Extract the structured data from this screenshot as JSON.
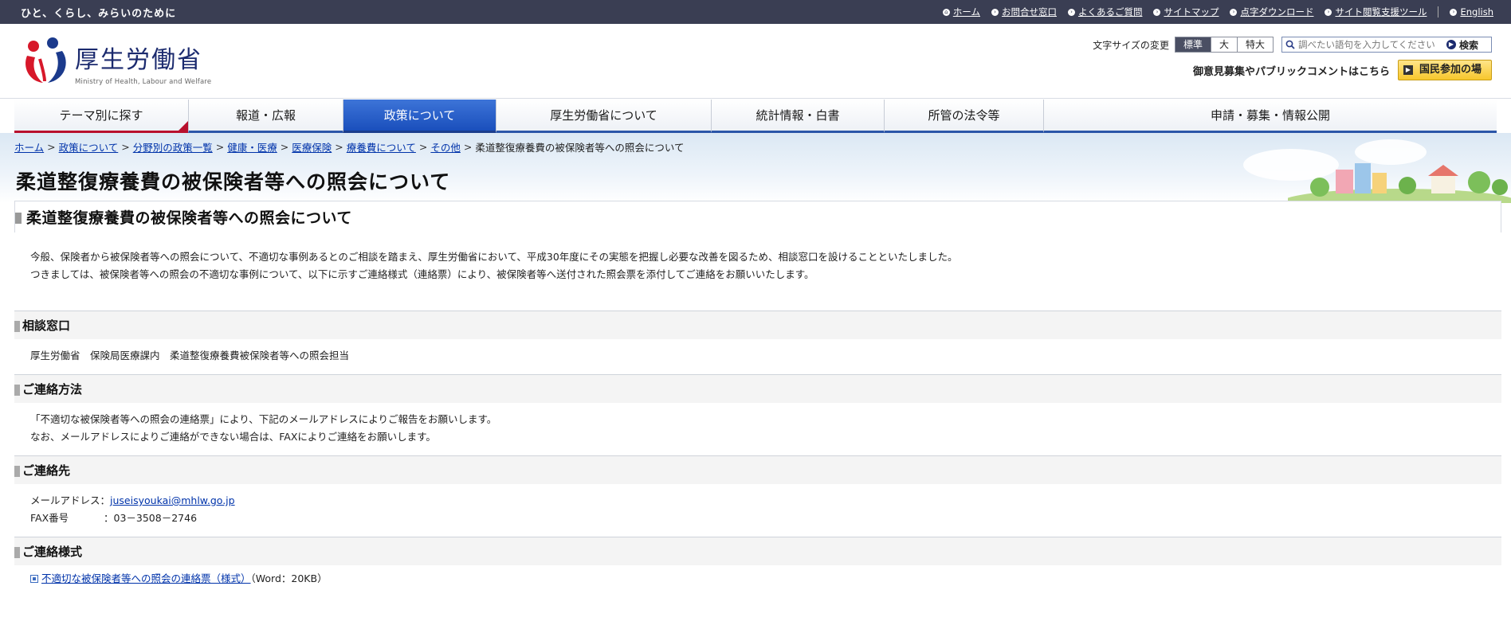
{
  "topbar": {
    "tagline": "ひと、くらし、みらいのために",
    "links": [
      "ホーム",
      "お問合せ窓口",
      "よくあるご質問",
      "サイトマップ",
      "点字ダウンロード",
      "サイト閲覧支援ツール"
    ],
    "english": "English"
  },
  "logo": {
    "jp": "厚生労働省",
    "en": "Ministry of Health, Labour and Welfare"
  },
  "font_size": {
    "label": "文字サイズの変更",
    "options": [
      "標準",
      "大",
      "特大"
    ],
    "selected": "標準"
  },
  "search": {
    "placeholder": "調べたい語句を入力してください",
    "button": "検索"
  },
  "public_comment": {
    "text": "御意見募集やパブリックコメントはこちら",
    "button": "国民参加の場"
  },
  "nav": {
    "items": [
      "テーマ別に探す",
      "報道・広報",
      "政策について",
      "厚生労働省について",
      "統計情報・白書",
      "所管の法令等",
      "申請・募集・情報公開"
    ],
    "active": "政策について"
  },
  "breadcrumb": [
    "ホーム",
    "政策について",
    "分野別の政策一覧",
    "健康・医療",
    "医療保険",
    "療養費について",
    "その他",
    "柔道整復療養費の被保険者等への照会について"
  ],
  "page": {
    "title": "柔道整復療養費の被保険者等への照会について",
    "heading": "柔道整復療養費の被保険者等への照会について",
    "intro": [
      "今般、保険者から被保険者等への照会について、不適切な事例あるとのご相談を踏まえ、厚生労働省において、平成30年度にその実態を把握し必要な改善を図るため、相談窓口を設けることといたしました。",
      "つきましては、被保険者等への照会の不適切な事例について、以下に示すご連絡様式（連絡票）により、被保険者等へ送付された照会票を添付してご連絡をお願いいたします。"
    ]
  },
  "sections": {
    "consult": {
      "heading": "相談窓口",
      "text": "厚生労働省　保険局医療課内　柔道整復療養費被保険者等への照会担当"
    },
    "method": {
      "heading": "ご連絡方法",
      "lines": [
        "「不適切な被保険者等への照会の連絡票」により、下記のメールアドレスによりご報告をお願いします。",
        "なお、メールアドレスによりご連絡ができない場合は、FAXによりご連絡をお願いします。"
      ]
    },
    "contact": {
      "heading": "ご連絡先",
      "email_label": "メールアドレス：",
      "email": "juseisyoukai@mhlw.go.jp",
      "fax_label": "FAX番号",
      "fax": "：03－3508－2746"
    },
    "form": {
      "heading": "ご連絡様式",
      "link": "不適切な被保険者等への照会の連絡票（様式）",
      "meta": "（Word：20KB）"
    }
  },
  "colors": {
    "topbar": "#3a3e53",
    "nav_active": "#1a4fbc",
    "accent_red": "#b8102d",
    "link": "#0033aa"
  }
}
